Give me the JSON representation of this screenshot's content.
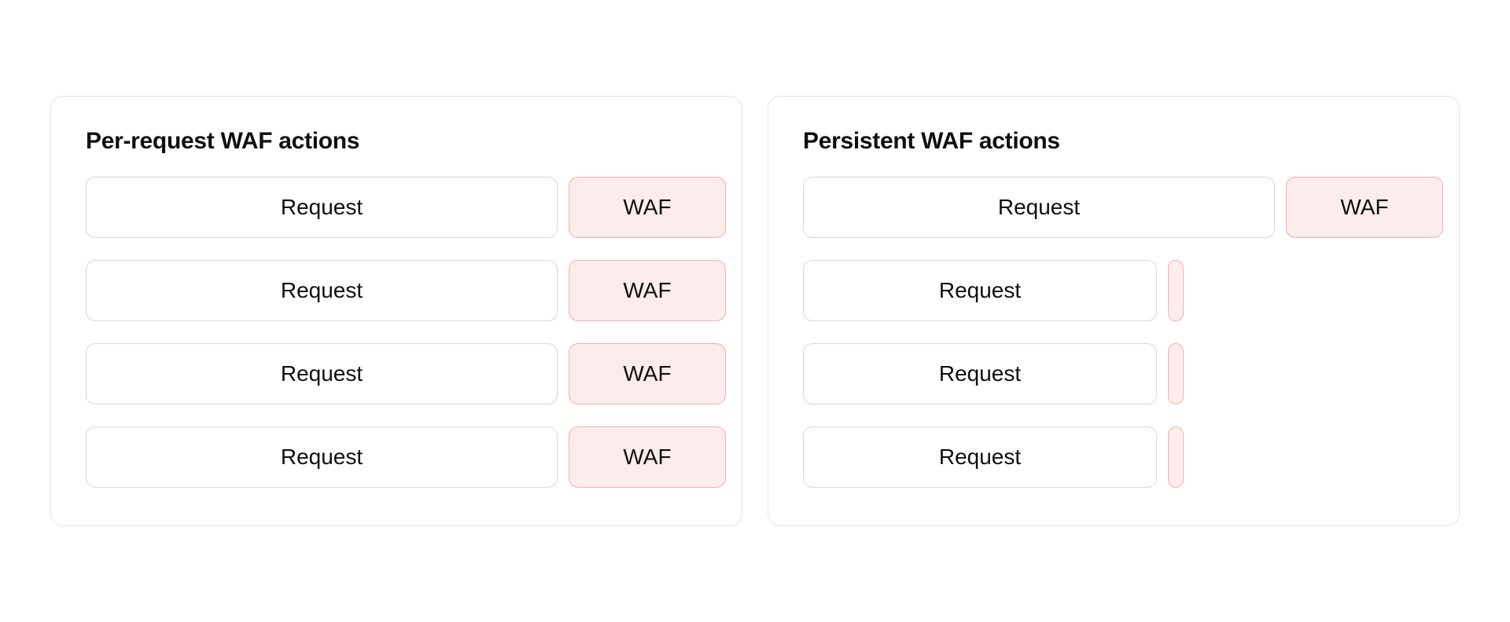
{
  "left": {
    "title": "Per-request WAF actions",
    "rows": [
      {
        "request": "Request",
        "waf": "WAF"
      },
      {
        "request": "Request",
        "waf": "WAF"
      },
      {
        "request": "Request",
        "waf": "WAF"
      },
      {
        "request": "Request",
        "waf": "WAF"
      }
    ]
  },
  "right": {
    "title": "Persistent WAF actions",
    "rows": [
      {
        "request": "Request",
        "waf": "WAF",
        "cached": false
      },
      {
        "request": "Request",
        "waf": "",
        "cached": true
      },
      {
        "request": "Request",
        "waf": "",
        "cached": true
      },
      {
        "request": "Request",
        "waf": "",
        "cached": true
      }
    ]
  }
}
